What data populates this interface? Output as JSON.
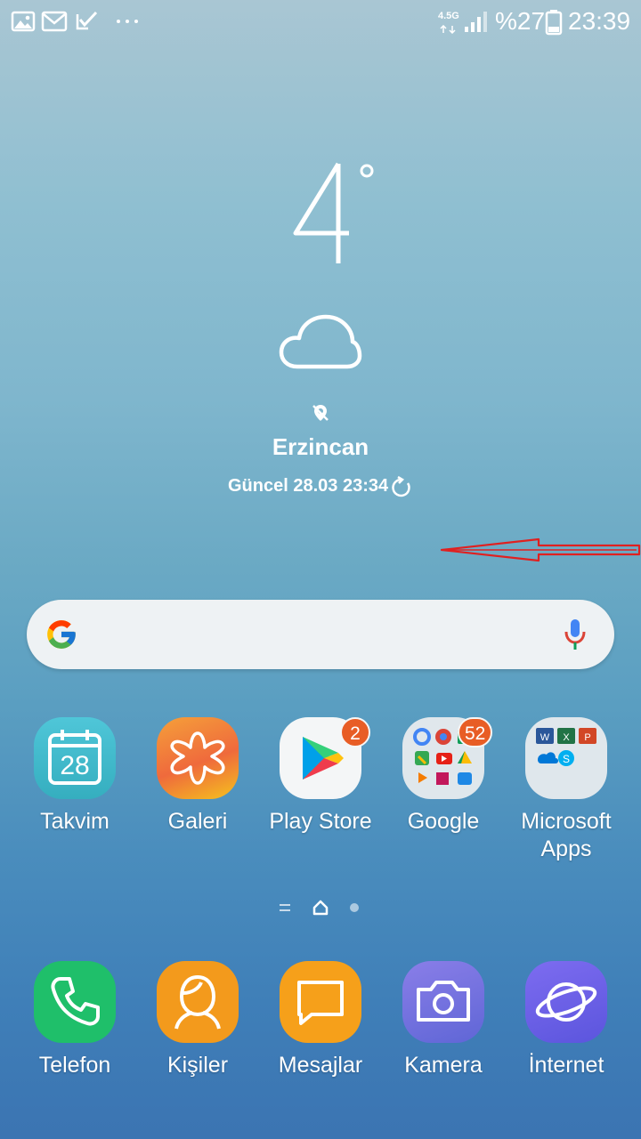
{
  "status_bar": {
    "network": "4.5G",
    "battery": "%27",
    "time": "23:39",
    "icons": [
      "gallery-icon",
      "email-icon",
      "task-icon",
      "more-dots-icon",
      "signal-icon",
      "battery-icon"
    ]
  },
  "weather": {
    "temperature": "4",
    "degree": "°",
    "condition_icon": "cloud-icon",
    "location_icon": "location-off-icon",
    "city": "Erzincan",
    "updated": "Güncel 28.03 23:34",
    "refresh_icon": "refresh-icon"
  },
  "search": {
    "logo": "google-g-icon",
    "mic_icon": "mic-icon"
  },
  "apps_row": [
    {
      "label": "Takvim",
      "icon": "calendar-icon",
      "day": "28"
    },
    {
      "label": "Galeri",
      "icon": "gallery-flower-icon"
    },
    {
      "label": "Play Store",
      "icon": "play-store-icon",
      "badge": "2"
    },
    {
      "label": "Google",
      "icon": "google-folder-icon",
      "badge": "52"
    },
    {
      "label": "Microsoft\nApps",
      "label_line1": "Microsoft",
      "label_line2": "Apps",
      "icon": "microsoft-folder-icon"
    }
  ],
  "page_indicator": {
    "current": "home",
    "items": [
      "menu-lines",
      "home",
      "dot"
    ]
  },
  "dock": [
    {
      "label": "Telefon",
      "icon": "phone-icon",
      "color": "#1fbf6a"
    },
    {
      "label": "Kişiler",
      "icon": "contacts-icon",
      "color": "#f39a1c"
    },
    {
      "label": "Mesajlar",
      "icon": "messages-icon",
      "color": "#f6a01a"
    },
    {
      "label": "Kamera",
      "icon": "camera-icon",
      "color": "#7b6fe0"
    },
    {
      "label": "İnternet",
      "icon": "internet-icon",
      "color": "#6b5fe3"
    }
  ],
  "colors": {
    "badge": "#e85d25",
    "annotation_arrow": "#e02020"
  }
}
